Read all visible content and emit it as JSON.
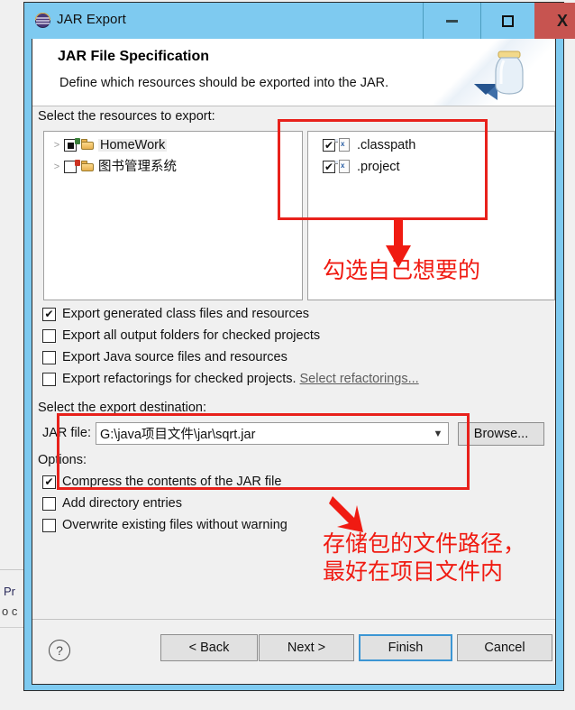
{
  "window": {
    "title": "JAR Export",
    "icon": "jar-export-icon",
    "controls": {
      "minimize": "minimize-icon",
      "maximize": "maximize-icon",
      "close": "X"
    }
  },
  "banner": {
    "heading": "JAR File Specification",
    "subheading": "Define which resources should be exported into the JAR.",
    "icon": "jar-bottle-icon"
  },
  "resources": {
    "label": "Select the resources to export:",
    "tree": [
      {
        "name": "HomeWork",
        "checkbox": "partial",
        "expander": ">",
        "icon": "project-folder-icon",
        "selected": true
      },
      {
        "name": "图书管理系统",
        "checkbox": "unchecked",
        "expander": ">",
        "icon": "project-folder-warning-icon",
        "selected": false
      }
    ],
    "files": [
      {
        "name": ".classpath",
        "checkbox": "checked",
        "icon": "xml-file-icon"
      },
      {
        "name": ".project",
        "checkbox": "checked",
        "icon": "xml-file-icon"
      }
    ]
  },
  "export_options": [
    {
      "label": "Export generated class files and resources",
      "checked": true
    },
    {
      "label": "Export all output folders for checked projects",
      "checked": false
    },
    {
      "label": "Export Java source files and resources",
      "checked": false
    },
    {
      "label": "Export refactorings for checked projects.",
      "checked": false,
      "link": "Select refactorings..."
    }
  ],
  "destination": {
    "label": "Select the export destination:",
    "field_label": "JAR file:",
    "value": "G:\\java项目文件\\jar\\sqrt.jar",
    "browse_label": "Browse...",
    "dropdown_arrow": "chevron-down-icon"
  },
  "options": {
    "label": "Options:",
    "items": [
      {
        "label": "Compress the contents of the JAR file",
        "checked": true
      },
      {
        "label": "Add directory entries",
        "checked": false
      },
      {
        "label": "Overwrite existing files without warning",
        "checked": false
      }
    ]
  },
  "footer": {
    "help": "?",
    "buttons": [
      {
        "label": "< Back",
        "primary": false
      },
      {
        "label": "Next >",
        "primary": false
      },
      {
        "label": "Finish",
        "primary": true
      },
      {
        "label": "Cancel",
        "primary": false
      }
    ]
  },
  "annotations": {
    "color": "#f01b12",
    "note_top": "勾选自己想要的",
    "note_bottom_line1": "存储包的文件路径，",
    "note_bottom_line2": "最好在项目文件内"
  },
  "background": {
    "fragment_1": "Pr",
    "fragment_2": "o c"
  }
}
